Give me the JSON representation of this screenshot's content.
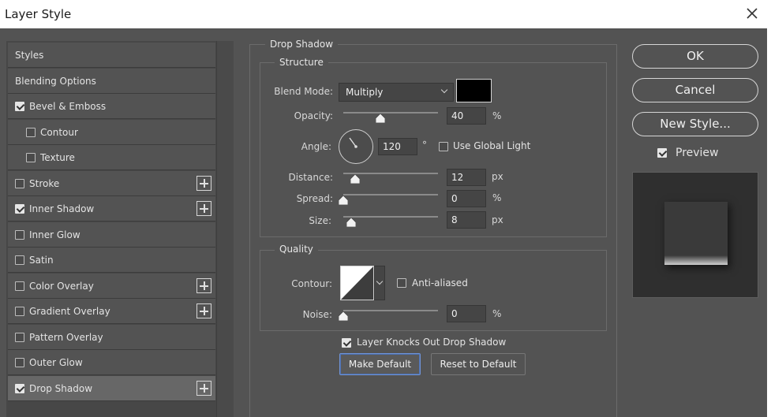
{
  "window": {
    "title": "Layer Style"
  },
  "style_list": {
    "items": [
      {
        "label": "Styles",
        "header": true
      },
      {
        "label": "Blending Options",
        "header": true
      },
      {
        "label": "Bevel & Emboss",
        "checked": true,
        "plus": false,
        "indent": false
      },
      {
        "label": "Contour",
        "checked": false,
        "plus": false,
        "indent": true
      },
      {
        "label": "Texture",
        "checked": false,
        "plus": false,
        "indent": true
      },
      {
        "label": "Stroke",
        "checked": false,
        "plus": true,
        "indent": false
      },
      {
        "label": "Inner Shadow",
        "checked": true,
        "plus": true,
        "indent": false
      },
      {
        "label": "Inner Glow",
        "checked": false,
        "plus": false,
        "indent": false
      },
      {
        "label": "Satin",
        "checked": false,
        "plus": false,
        "indent": false
      },
      {
        "label": "Color Overlay",
        "checked": false,
        "plus": true,
        "indent": false
      },
      {
        "label": "Gradient Overlay",
        "checked": false,
        "plus": true,
        "indent": false
      },
      {
        "label": "Pattern Overlay",
        "checked": false,
        "plus": false,
        "indent": false
      },
      {
        "label": "Outer Glow",
        "checked": false,
        "plus": false,
        "indent": false
      },
      {
        "label": "Drop Shadow",
        "checked": true,
        "plus": true,
        "indent": false,
        "selected": true
      }
    ]
  },
  "drop_shadow": {
    "section_title": "Drop Shadow",
    "structure": {
      "title": "Structure",
      "blend_mode_label": "Blend Mode:",
      "blend_mode_value": "Multiply",
      "shadow_color": "#000000",
      "opacity_label": "Opacity:",
      "opacity_value": "40",
      "opacity_unit": "%",
      "angle_label": "Angle:",
      "angle_value": "120",
      "angle_unit": "°",
      "use_global_light_label": "Use Global Light",
      "use_global_light": false,
      "distance_label": "Distance:",
      "distance_value": "12",
      "distance_unit": "px",
      "spread_label": "Spread:",
      "spread_value": "0",
      "spread_unit": "%",
      "size_label": "Size:",
      "size_value": "8",
      "size_unit": "px"
    },
    "quality": {
      "title": "Quality",
      "contour_label": "Contour:",
      "anti_aliased_label": "Anti-aliased",
      "anti_aliased": false,
      "noise_label": "Noise:",
      "noise_value": "0",
      "noise_unit": "%"
    },
    "knockout_label": "Layer Knocks Out Drop Shadow",
    "knockout": true,
    "make_default_label": "Make Default",
    "reset_default_label": "Reset to Default"
  },
  "actions": {
    "ok_label": "OK",
    "cancel_label": "Cancel",
    "new_style_label": "New Style...",
    "preview_label": "Preview",
    "preview_checked": true
  },
  "icons": {
    "close": "close-icon",
    "checkbox": "checkbox-icon",
    "add": "plus-icon",
    "dropdown": "chevron-down-icon",
    "angle": "angle-dial-icon",
    "contour": "contour-curve-icon"
  }
}
